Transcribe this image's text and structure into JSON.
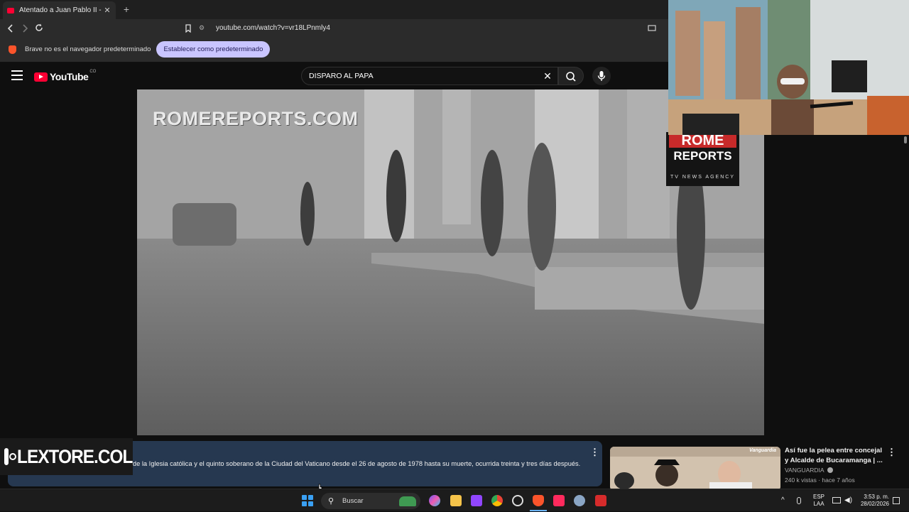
{
  "browser": {
    "tab_title": "Atentado a Juan Pablo II - YouTu",
    "tab_close": "✕",
    "new_tab": "+",
    "url": "youtube.com/watch?v=vr18LPnmly4",
    "infobar_text": "Brave no es el navegador predeterminado",
    "infobar_button": "Establecer como predeterminado"
  },
  "youtube": {
    "logo_text": "YouTube",
    "country_code": "CO",
    "search_value": "DISPARO AL PAPA",
    "clear_symbol": "✕"
  },
  "video": {
    "watermark": "ROMEREPORTS.COM",
    "logo_line1": "ROME",
    "logo_line2": "REPORTS",
    "logo_line3": "TV NEWS AGENCY"
  },
  "description": {
    "text": "...ular Albino Luciani, fue el 263.er papa de la Iglesia católica y el quinto soberano de la Ciudad del Vaticano desde el 26 de agosto de 1978 hasta su muerte, ocurrida treinta y tres días después.",
    "more_symbol": "⋮"
  },
  "overlay": {
    "instagram_handle": "LEXTORE.COL"
  },
  "recommended": {
    "title": "Así fue la pelea entre concejal y Alcalde de Bucaramanga | ...",
    "channel": "VANGUARDIA",
    "meta": "240 k vistas · hace 7 años",
    "thumb_brand": "Vanguardia",
    "more_symbol": "⋮"
  },
  "taskbar": {
    "search_placeholder": "Buscar",
    "lang_line1": "ESP",
    "lang_line2": "LAA",
    "time": "3:53 p. m.",
    "date": "28/02/2026"
  },
  "colors": {
    "youtube_red": "#ff0033",
    "description_bg": "#263850",
    "infobar_button_bg": "#c9c5ff"
  }
}
